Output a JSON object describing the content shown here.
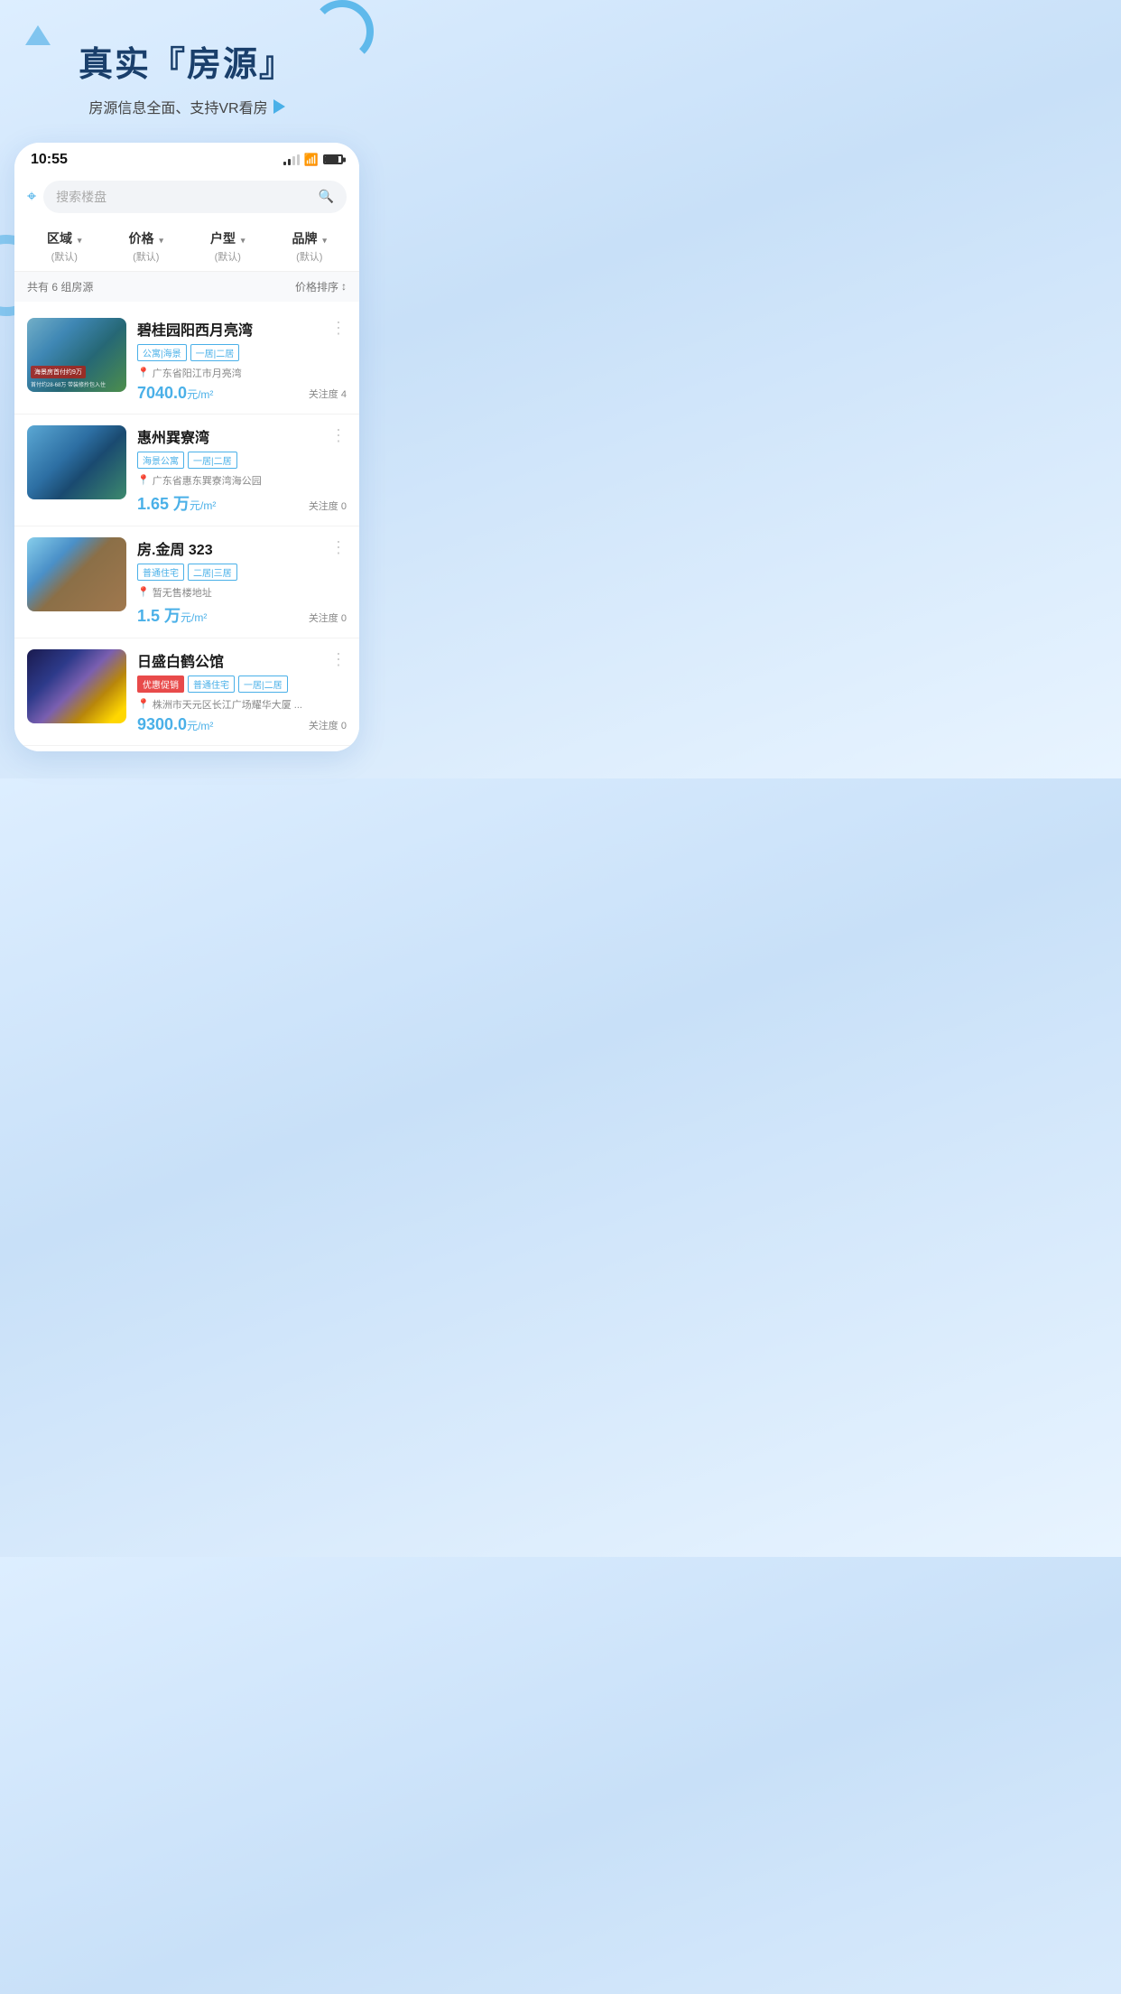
{
  "page": {
    "background": "#c8e0f8"
  },
  "hero": {
    "title": "真实『房源』",
    "subtitle": "房源信息全面、支持VR看房",
    "play_icon": "▷"
  },
  "phone": {
    "time": "10:55",
    "search": {
      "placeholder": "搜索楼盘",
      "location_icon": "📍"
    },
    "filters": [
      {
        "label": "区域",
        "sub": "(默认)"
      },
      {
        "label": "价格",
        "sub": "(默认)"
      },
      {
        "label": "户型",
        "sub": "(默认)"
      },
      {
        "label": "品牌",
        "sub": "(默认)"
      }
    ],
    "results": {
      "count_text": "共有 6 组房源",
      "sort_text": "价格排序"
    },
    "listings": [
      {
        "title": "碧桂园阳西月亮湾",
        "tags": [
          "公寓|海景",
          "一居|二居"
        ],
        "tag_types": [
          "blue",
          "blue"
        ],
        "location": "广东省阳江市月亮湾",
        "price": "7040.0",
        "price_unit": "元/m²",
        "attention": "关注度 4",
        "img_class": "img-1",
        "badge": "首付约9万"
      },
      {
        "title": "惠州巽寮湾",
        "tags": [
          "海景公寓",
          "一居|二居"
        ],
        "tag_types": [
          "blue",
          "blue"
        ],
        "location": "广东省惠东巽寮湾海公园",
        "price": "1.65 万",
        "price_unit": "元/m²",
        "attention": "关注度 0",
        "img_class": "img-2",
        "badge": ""
      },
      {
        "title": "房.金周 323",
        "tags": [
          "普通住宅",
          "二居|三居"
        ],
        "tag_types": [
          "blue",
          "blue"
        ],
        "location": "暂无售楼地址",
        "price": "1.5 万",
        "price_unit": "元/m²",
        "attention": "关注度 0",
        "img_class": "img-3",
        "badge": ""
      },
      {
        "title": "日盛白鹤公馆",
        "tags": [
          "优惠促销",
          "普通住宅",
          "一居|二居"
        ],
        "tag_types": [
          "red",
          "blue",
          "blue"
        ],
        "location": "株洲市天元区长江广场耀华大厦 ...",
        "price": "9300.0",
        "price_unit": "元/m²",
        "attention": "关注度 0",
        "img_class": "img-4",
        "badge": ""
      }
    ]
  }
}
